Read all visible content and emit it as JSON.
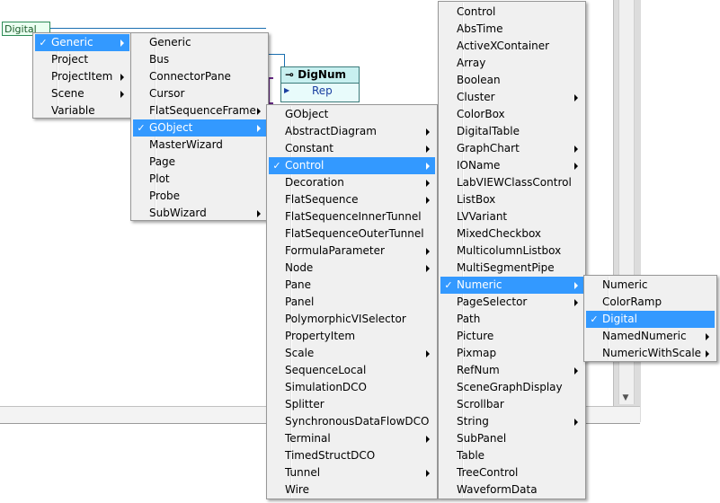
{
  "background": {
    "node_digital_label": "Digital",
    "node_dignum_title": "DigNum",
    "node_dignum_row": "Rep",
    "colors": {
      "selection": "#3399ff",
      "menu_bg": "#f0f0f0",
      "wire": "#1a6fb0"
    }
  },
  "menus": {
    "m1": [
      {
        "label": "Generic",
        "checked": true,
        "sub": true,
        "selected": true
      },
      {
        "label": "Project",
        "checked": false,
        "sub": false,
        "selected": false
      },
      {
        "label": "ProjectItem",
        "checked": false,
        "sub": true,
        "selected": false
      },
      {
        "label": "Scene",
        "checked": false,
        "sub": true,
        "selected": false
      },
      {
        "label": "Variable",
        "checked": false,
        "sub": false,
        "selected": false
      }
    ],
    "m2": [
      {
        "label": "Generic",
        "checked": false,
        "sub": false,
        "selected": false
      },
      {
        "label": "Bus",
        "checked": false,
        "sub": false,
        "selected": false
      },
      {
        "label": "ConnectorPane",
        "checked": false,
        "sub": false,
        "selected": false
      },
      {
        "label": "Cursor",
        "checked": false,
        "sub": false,
        "selected": false
      },
      {
        "label": "FlatSequenceFrame",
        "checked": false,
        "sub": true,
        "selected": false
      },
      {
        "label": "GObject",
        "checked": true,
        "sub": true,
        "selected": true
      },
      {
        "label": "MasterWizard",
        "checked": false,
        "sub": false,
        "selected": false
      },
      {
        "label": "Page",
        "checked": false,
        "sub": false,
        "selected": false
      },
      {
        "label": "Plot",
        "checked": false,
        "sub": false,
        "selected": false
      },
      {
        "label": "Probe",
        "checked": false,
        "sub": false,
        "selected": false
      },
      {
        "label": "SubWizard",
        "checked": false,
        "sub": true,
        "selected": false
      }
    ],
    "m3": [
      {
        "label": "GObject",
        "checked": false,
        "sub": false,
        "selected": false
      },
      {
        "label": "AbstractDiagram",
        "checked": false,
        "sub": true,
        "selected": false
      },
      {
        "label": "Constant",
        "checked": false,
        "sub": true,
        "selected": false
      },
      {
        "label": "Control",
        "checked": true,
        "sub": true,
        "selected": true
      },
      {
        "label": "Decoration",
        "checked": false,
        "sub": true,
        "selected": false
      },
      {
        "label": "FlatSequence",
        "checked": false,
        "sub": true,
        "selected": false
      },
      {
        "label": "FlatSequenceInnerTunnel",
        "checked": false,
        "sub": false,
        "selected": false
      },
      {
        "label": "FlatSequenceOuterTunnel",
        "checked": false,
        "sub": false,
        "selected": false
      },
      {
        "label": "FormulaParameter",
        "checked": false,
        "sub": true,
        "selected": false
      },
      {
        "label": "Node",
        "checked": false,
        "sub": true,
        "selected": false
      },
      {
        "label": "Pane",
        "checked": false,
        "sub": false,
        "selected": false
      },
      {
        "label": "Panel",
        "checked": false,
        "sub": false,
        "selected": false
      },
      {
        "label": "PolymorphicVISelector",
        "checked": false,
        "sub": false,
        "selected": false
      },
      {
        "label": "PropertyItem",
        "checked": false,
        "sub": false,
        "selected": false
      },
      {
        "label": "Scale",
        "checked": false,
        "sub": true,
        "selected": false
      },
      {
        "label": "SequenceLocal",
        "checked": false,
        "sub": false,
        "selected": false
      },
      {
        "label": "SimulationDCO",
        "checked": false,
        "sub": false,
        "selected": false
      },
      {
        "label": "Splitter",
        "checked": false,
        "sub": false,
        "selected": false
      },
      {
        "label": "SynchronousDataFlowDCO",
        "checked": false,
        "sub": false,
        "selected": false
      },
      {
        "label": "Terminal",
        "checked": false,
        "sub": true,
        "selected": false
      },
      {
        "label": "TimedStructDCO",
        "checked": false,
        "sub": false,
        "selected": false
      },
      {
        "label": "Tunnel",
        "checked": false,
        "sub": true,
        "selected": false
      },
      {
        "label": "Wire",
        "checked": false,
        "sub": false,
        "selected": false
      }
    ],
    "m4": [
      {
        "label": "Control",
        "checked": false,
        "sub": false,
        "selected": false
      },
      {
        "label": "AbsTime",
        "checked": false,
        "sub": false,
        "selected": false
      },
      {
        "label": "ActiveXContainer",
        "checked": false,
        "sub": false,
        "selected": false
      },
      {
        "label": "Array",
        "checked": false,
        "sub": false,
        "selected": false
      },
      {
        "label": "Boolean",
        "checked": false,
        "sub": false,
        "selected": false
      },
      {
        "label": "Cluster",
        "checked": false,
        "sub": true,
        "selected": false
      },
      {
        "label": "ColorBox",
        "checked": false,
        "sub": false,
        "selected": false
      },
      {
        "label": "DigitalTable",
        "checked": false,
        "sub": false,
        "selected": false
      },
      {
        "label": "GraphChart",
        "checked": false,
        "sub": true,
        "selected": false
      },
      {
        "label": "IOName",
        "checked": false,
        "sub": true,
        "selected": false
      },
      {
        "label": "LabVIEWClassControl",
        "checked": false,
        "sub": false,
        "selected": false
      },
      {
        "label": "ListBox",
        "checked": false,
        "sub": false,
        "selected": false
      },
      {
        "label": "LVVariant",
        "checked": false,
        "sub": false,
        "selected": false
      },
      {
        "label": "MixedCheckbox",
        "checked": false,
        "sub": false,
        "selected": false
      },
      {
        "label": "MulticolumnListbox",
        "checked": false,
        "sub": false,
        "selected": false
      },
      {
        "label": "MultiSegmentPipe",
        "checked": false,
        "sub": false,
        "selected": false
      },
      {
        "label": "Numeric",
        "checked": true,
        "sub": true,
        "selected": true
      },
      {
        "label": "PageSelector",
        "checked": false,
        "sub": true,
        "selected": false
      },
      {
        "label": "Path",
        "checked": false,
        "sub": false,
        "selected": false
      },
      {
        "label": "Picture",
        "checked": false,
        "sub": false,
        "selected": false
      },
      {
        "label": "Pixmap",
        "checked": false,
        "sub": false,
        "selected": false
      },
      {
        "label": "RefNum",
        "checked": false,
        "sub": true,
        "selected": false
      },
      {
        "label": "SceneGraphDisplay",
        "checked": false,
        "sub": false,
        "selected": false
      },
      {
        "label": "Scrollbar",
        "checked": false,
        "sub": false,
        "selected": false
      },
      {
        "label": "String",
        "checked": false,
        "sub": true,
        "selected": false
      },
      {
        "label": "SubPanel",
        "checked": false,
        "sub": false,
        "selected": false
      },
      {
        "label": "Table",
        "checked": false,
        "sub": false,
        "selected": false
      },
      {
        "label": "TreeControl",
        "checked": false,
        "sub": false,
        "selected": false
      },
      {
        "label": "WaveformData",
        "checked": false,
        "sub": false,
        "selected": false
      }
    ],
    "m5": [
      {
        "label": "Numeric",
        "checked": false,
        "sub": false,
        "selected": false
      },
      {
        "label": "ColorRamp",
        "checked": false,
        "sub": false,
        "selected": false
      },
      {
        "label": "Digital",
        "checked": true,
        "sub": false,
        "selected": true
      },
      {
        "label": "NamedNumeric",
        "checked": false,
        "sub": true,
        "selected": false
      },
      {
        "label": "NumericWithScale",
        "checked": false,
        "sub": true,
        "selected": false
      }
    ]
  }
}
